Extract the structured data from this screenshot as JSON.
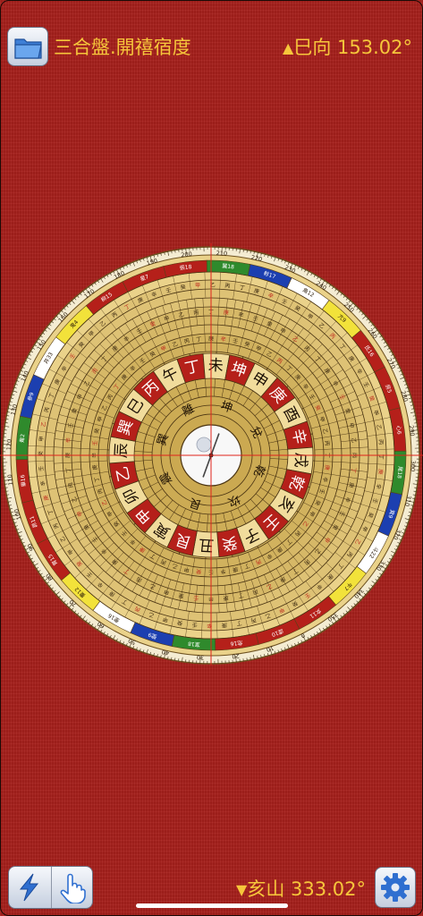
{
  "header": {
    "title": "三合盤.開禧宿度",
    "facing_marker": "▲",
    "facing_label": "巳向 153.02°"
  },
  "footer": {
    "sitting_marker": "▼",
    "sitting_label": "亥山 333.02°"
  },
  "compass": {
    "rotation_deg": 153.02,
    "inner_ring": [
      "坎",
      "艮",
      "震",
      "巽",
      "離",
      "坤",
      "兌",
      "乾"
    ],
    "mountain_ring": [
      "子",
      "癸",
      "丑",
      "艮",
      "寅",
      "甲",
      "卯",
      "乙",
      "辰",
      "巽",
      "巳",
      "丙",
      "午",
      "丁",
      "未",
      "坤",
      "申",
      "庚",
      "酉",
      "辛",
      "戌",
      "乾",
      "亥",
      "壬"
    ],
    "degree_labels": [
      "0",
      "10",
      "20",
      "30",
      "40",
      "50",
      "60",
      "70",
      "80",
      "90",
      "100",
      "110",
      "120",
      "130",
      "140",
      "150",
      "160",
      "170",
      "180",
      "190",
      "200",
      "210",
      "220",
      "230",
      "240",
      "250",
      "260",
      "270",
      "280",
      "290",
      "300",
      "310",
      "320",
      "330",
      "340",
      "350"
    ],
    "mansion_labels": [
      "虛10",
      "危16",
      "室18",
      "壁9",
      "奎16",
      "婁12",
      "胃15",
      "昴11",
      "畢16",
      "觜2",
      "參9",
      "井33",
      "鬼4",
      "柳15",
      "星7",
      "張18",
      "翼18",
      "軫17",
      "角12",
      "亢9",
      "氐16",
      "房5",
      "心6",
      "尾18",
      "箕9",
      "斗22",
      "牛7",
      "女11"
    ],
    "colors": {
      "face": "#ead28a",
      "face_dark": "#c9a64c",
      "ink": "#2a1a08",
      "red_band": "#b5201a",
      "green_band": "#2f8a2c",
      "blue_band": "#1c3fb0",
      "yellow_band": "#f2e23a",
      "crosshair": "#e0221a"
    }
  }
}
